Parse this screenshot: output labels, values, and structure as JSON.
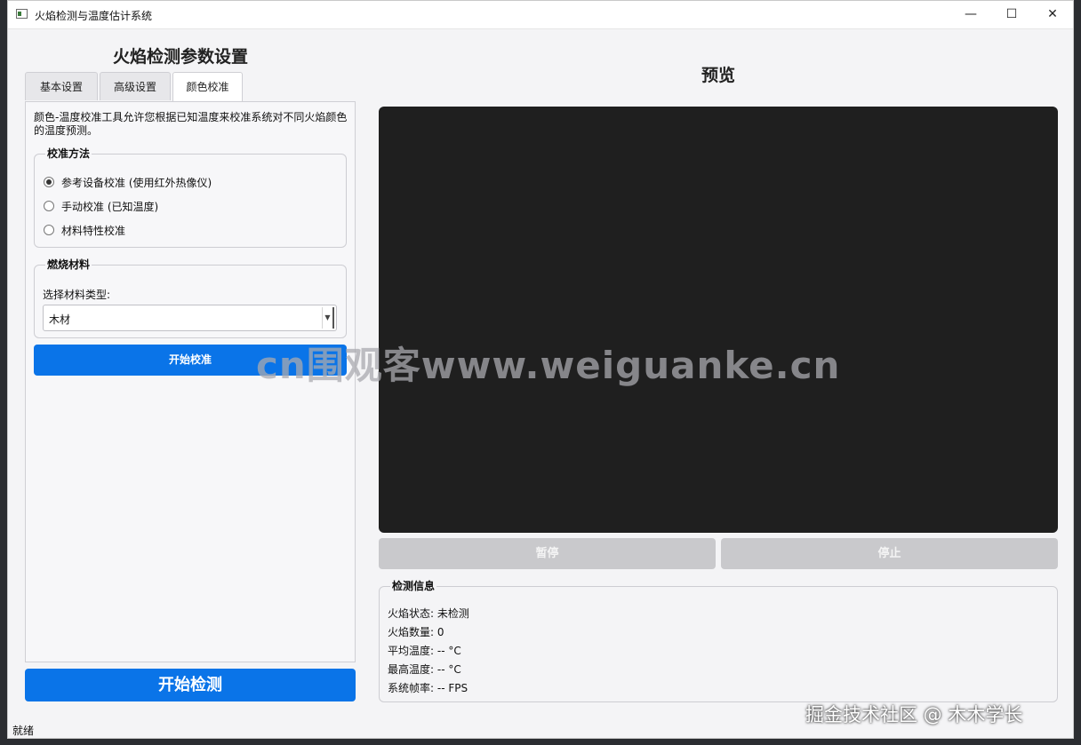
{
  "window": {
    "title": "火焰检测与温度估计系统",
    "minimize": "—",
    "maximize": "☐",
    "close": "✕"
  },
  "left_panel": {
    "title": "火焰检测参数设置",
    "tabs": [
      "基本设置",
      "高级设置",
      "颜色校准"
    ],
    "active_tab": "颜色校准",
    "description": "颜色-温度校准工具允许您根据已知温度来校准系统对不同火焰颜色的温度预测。",
    "calibration_method": {
      "title": "校准方法",
      "options": [
        "参考设备校准 (使用红外热像仪)",
        "手动校准 (已知温度)",
        "材料特性校准"
      ],
      "selected_index": 0
    },
    "material": {
      "title": "燃烧材料",
      "label": "选择材料类型:",
      "selected": "木材"
    },
    "calibrate_button": "开始校准",
    "detect_button": "开始检测"
  },
  "preview": {
    "title": "预览",
    "pause_button": "暂停",
    "stop_button": "停止"
  },
  "info": {
    "title": "检测信息",
    "lines": [
      "火焰状态: 未检测",
      "火焰数量: 0",
      "平均温度: -- °C",
      "最高温度: -- °C",
      "系统帧率: -- FPS"
    ]
  },
  "status": "就绪",
  "overlay": {
    "watermark": "cn围观客www.weiguanke.cn",
    "credit": "掘金技术社区 @ 木木学长"
  },
  "colors": {
    "accent": "#0a74e8",
    "preview_bg": "#1f1f1f",
    "disabled_btn": "#c9c9cc"
  }
}
